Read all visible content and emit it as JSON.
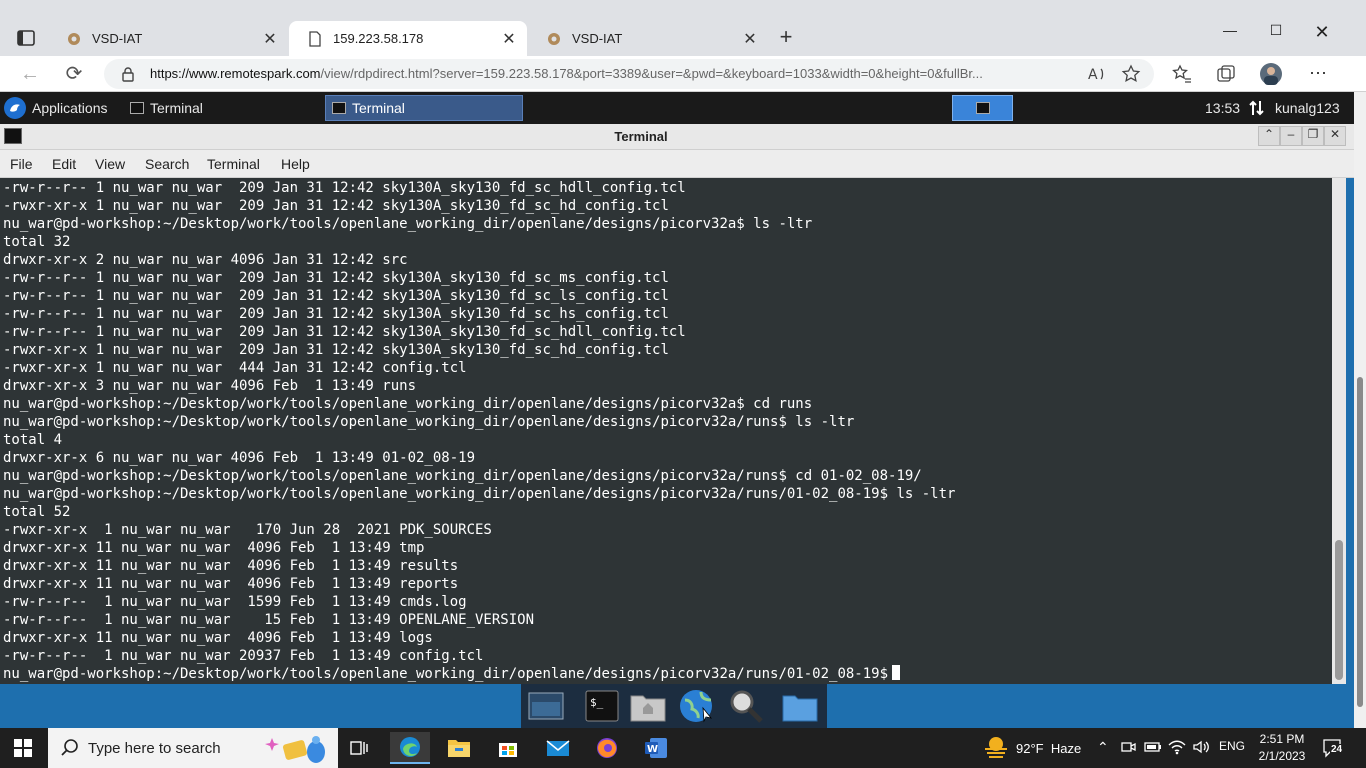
{
  "browser": {
    "tabs": [
      {
        "title": "VSD-IAT",
        "active": false
      },
      {
        "title": "159.223.58.178",
        "active": true
      },
      {
        "title": "VSD-IAT",
        "active": false
      }
    ],
    "url_host": "https://www.remotespark.com",
    "url_rest": "/view/rdpdirect.html?server=159.223.58.178&port=3389&user=&pwd=&keyboard=1033&width=0&height=0&fullBr..."
  },
  "xfce": {
    "applications_label": "Applications",
    "tasks": [
      "Terminal",
      "Terminal"
    ],
    "clock": "13:53",
    "user": "kunalg123"
  },
  "terminal": {
    "title": "Terminal",
    "menu": [
      "File",
      "Edit",
      "View",
      "Search",
      "Terminal",
      "Help"
    ],
    "lines": [
      "-rw-r--r-- 1 nu_war nu_war  209 Jan 31 12:42 sky130A_sky130_fd_sc_hdll_config.tcl",
      "-rwxr-xr-x 1 nu_war nu_war  209 Jan 31 12:42 sky130A_sky130_fd_sc_hd_config.tcl",
      "nu_war@pd-workshop:~/Desktop/work/tools/openlane_working_dir/openlane/designs/picorv32a$ ls -ltr",
      "total 32",
      "drwxr-xr-x 2 nu_war nu_war 4096 Jan 31 12:42 src",
      "-rw-r--r-- 1 nu_war nu_war  209 Jan 31 12:42 sky130A_sky130_fd_sc_ms_config.tcl",
      "-rw-r--r-- 1 nu_war nu_war  209 Jan 31 12:42 sky130A_sky130_fd_sc_ls_config.tcl",
      "-rw-r--r-- 1 nu_war nu_war  209 Jan 31 12:42 sky130A_sky130_fd_sc_hs_config.tcl",
      "-rw-r--r-- 1 nu_war nu_war  209 Jan 31 12:42 sky130A_sky130_fd_sc_hdll_config.tcl",
      "-rwxr-xr-x 1 nu_war nu_war  209 Jan 31 12:42 sky130A_sky130_fd_sc_hd_config.tcl",
      "-rwxr-xr-x 1 nu_war nu_war  444 Jan 31 12:42 config.tcl",
      "drwxr-xr-x 3 nu_war nu_war 4096 Feb  1 13:49 runs",
      "nu_war@pd-workshop:~/Desktop/work/tools/openlane_working_dir/openlane/designs/picorv32a$ cd runs",
      "nu_war@pd-workshop:~/Desktop/work/tools/openlane_working_dir/openlane/designs/picorv32a/runs$ ls -ltr",
      "total 4",
      "drwxr-xr-x 6 nu_war nu_war 4096 Feb  1 13:49 01-02_08-19",
      "nu_war@pd-workshop:~/Desktop/work/tools/openlane_working_dir/openlane/designs/picorv32a/runs$ cd 01-02_08-19/",
      "nu_war@pd-workshop:~/Desktop/work/tools/openlane_working_dir/openlane/designs/picorv32a/runs/01-02_08-19$ ls -ltr",
      "total 52",
      "-rwxr-xr-x  1 nu_war nu_war   170 Jun 28  2021 PDK_SOURCES",
      "drwxr-xr-x 11 nu_war nu_war  4096 Feb  1 13:49 tmp",
      "drwxr-xr-x 11 nu_war nu_war  4096 Feb  1 13:49 results",
      "drwxr-xr-x 11 nu_war nu_war  4096 Feb  1 13:49 reports",
      "-rw-r--r--  1 nu_war nu_war  1599 Feb  1 13:49 cmds.log",
      "-rw-r--r--  1 nu_war nu_war    15 Feb  1 13:49 OPENLANE_VERSION",
      "drwxr-xr-x 11 nu_war nu_war  4096 Feb  1 13:49 logs",
      "-rw-r--r--  1 nu_war nu_war 20937 Feb  1 13:49 config.tcl"
    ],
    "prompt": "nu_war@pd-workshop:~/Desktop/work/tools/openlane_working_dir/openlane/designs/picorv32a/runs/01-02_08-19$ "
  },
  "windows": {
    "search_placeholder": "Type here to search",
    "weather": "92°F  Haze",
    "language": "ENG",
    "time": "2:51 PM",
    "date": "2/1/2023",
    "notifications": "24"
  }
}
